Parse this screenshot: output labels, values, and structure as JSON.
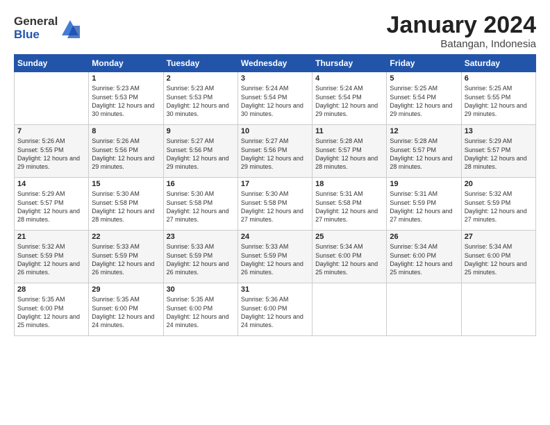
{
  "logo": {
    "general": "General",
    "blue": "Blue"
  },
  "title": "January 2024",
  "location": "Batangan, Indonesia",
  "days": [
    "Sunday",
    "Monday",
    "Tuesday",
    "Wednesday",
    "Thursday",
    "Friday",
    "Saturday"
  ],
  "weeks": [
    [
      {
        "num": "",
        "sunrise": "",
        "sunset": "",
        "daylight": ""
      },
      {
        "num": "1",
        "sunrise": "5:23 AM",
        "sunset": "5:53 PM",
        "daylight": "12 hours and 30 minutes."
      },
      {
        "num": "2",
        "sunrise": "5:23 AM",
        "sunset": "5:53 PM",
        "daylight": "12 hours and 30 minutes."
      },
      {
        "num": "3",
        "sunrise": "5:24 AM",
        "sunset": "5:54 PM",
        "daylight": "12 hours and 30 minutes."
      },
      {
        "num": "4",
        "sunrise": "5:24 AM",
        "sunset": "5:54 PM",
        "daylight": "12 hours and 29 minutes."
      },
      {
        "num": "5",
        "sunrise": "5:25 AM",
        "sunset": "5:54 PM",
        "daylight": "12 hours and 29 minutes."
      },
      {
        "num": "6",
        "sunrise": "5:25 AM",
        "sunset": "5:55 PM",
        "daylight": "12 hours and 29 minutes."
      }
    ],
    [
      {
        "num": "7",
        "sunrise": "5:26 AM",
        "sunset": "5:55 PM",
        "daylight": "12 hours and 29 minutes."
      },
      {
        "num": "8",
        "sunrise": "5:26 AM",
        "sunset": "5:56 PM",
        "daylight": "12 hours and 29 minutes."
      },
      {
        "num": "9",
        "sunrise": "5:27 AM",
        "sunset": "5:56 PM",
        "daylight": "12 hours and 29 minutes."
      },
      {
        "num": "10",
        "sunrise": "5:27 AM",
        "sunset": "5:56 PM",
        "daylight": "12 hours and 29 minutes."
      },
      {
        "num": "11",
        "sunrise": "5:28 AM",
        "sunset": "5:57 PM",
        "daylight": "12 hours and 28 minutes."
      },
      {
        "num": "12",
        "sunrise": "5:28 AM",
        "sunset": "5:57 PM",
        "daylight": "12 hours and 28 minutes."
      },
      {
        "num": "13",
        "sunrise": "5:29 AM",
        "sunset": "5:57 PM",
        "daylight": "12 hours and 28 minutes."
      }
    ],
    [
      {
        "num": "14",
        "sunrise": "5:29 AM",
        "sunset": "5:57 PM",
        "daylight": "12 hours and 28 minutes."
      },
      {
        "num": "15",
        "sunrise": "5:30 AM",
        "sunset": "5:58 PM",
        "daylight": "12 hours and 28 minutes."
      },
      {
        "num": "16",
        "sunrise": "5:30 AM",
        "sunset": "5:58 PM",
        "daylight": "12 hours and 27 minutes."
      },
      {
        "num": "17",
        "sunrise": "5:30 AM",
        "sunset": "5:58 PM",
        "daylight": "12 hours and 27 minutes."
      },
      {
        "num": "18",
        "sunrise": "5:31 AM",
        "sunset": "5:58 PM",
        "daylight": "12 hours and 27 minutes."
      },
      {
        "num": "19",
        "sunrise": "5:31 AM",
        "sunset": "5:59 PM",
        "daylight": "12 hours and 27 minutes."
      },
      {
        "num": "20",
        "sunrise": "5:32 AM",
        "sunset": "5:59 PM",
        "daylight": "12 hours and 27 minutes."
      }
    ],
    [
      {
        "num": "21",
        "sunrise": "5:32 AM",
        "sunset": "5:59 PM",
        "daylight": "12 hours and 26 minutes."
      },
      {
        "num": "22",
        "sunrise": "5:33 AM",
        "sunset": "5:59 PM",
        "daylight": "12 hours and 26 minutes."
      },
      {
        "num": "23",
        "sunrise": "5:33 AM",
        "sunset": "5:59 PM",
        "daylight": "12 hours and 26 minutes."
      },
      {
        "num": "24",
        "sunrise": "5:33 AM",
        "sunset": "5:59 PM",
        "daylight": "12 hours and 26 minutes."
      },
      {
        "num": "25",
        "sunrise": "5:34 AM",
        "sunset": "6:00 PM",
        "daylight": "12 hours and 25 minutes."
      },
      {
        "num": "26",
        "sunrise": "5:34 AM",
        "sunset": "6:00 PM",
        "daylight": "12 hours and 25 minutes."
      },
      {
        "num": "27",
        "sunrise": "5:34 AM",
        "sunset": "6:00 PM",
        "daylight": "12 hours and 25 minutes."
      }
    ],
    [
      {
        "num": "28",
        "sunrise": "5:35 AM",
        "sunset": "6:00 PM",
        "daylight": "12 hours and 25 minutes."
      },
      {
        "num": "29",
        "sunrise": "5:35 AM",
        "sunset": "6:00 PM",
        "daylight": "12 hours and 24 minutes."
      },
      {
        "num": "30",
        "sunrise": "5:35 AM",
        "sunset": "6:00 PM",
        "daylight": "12 hours and 24 minutes."
      },
      {
        "num": "31",
        "sunrise": "5:36 AM",
        "sunset": "6:00 PM",
        "daylight": "12 hours and 24 minutes."
      },
      {
        "num": "",
        "sunrise": "",
        "sunset": "",
        "daylight": ""
      },
      {
        "num": "",
        "sunrise": "",
        "sunset": "",
        "daylight": ""
      },
      {
        "num": "",
        "sunrise": "",
        "sunset": "",
        "daylight": ""
      }
    ]
  ],
  "labels": {
    "sunrise_prefix": "Sunrise: ",
    "sunset_prefix": "Sunset: ",
    "daylight_prefix": "Daylight: "
  }
}
